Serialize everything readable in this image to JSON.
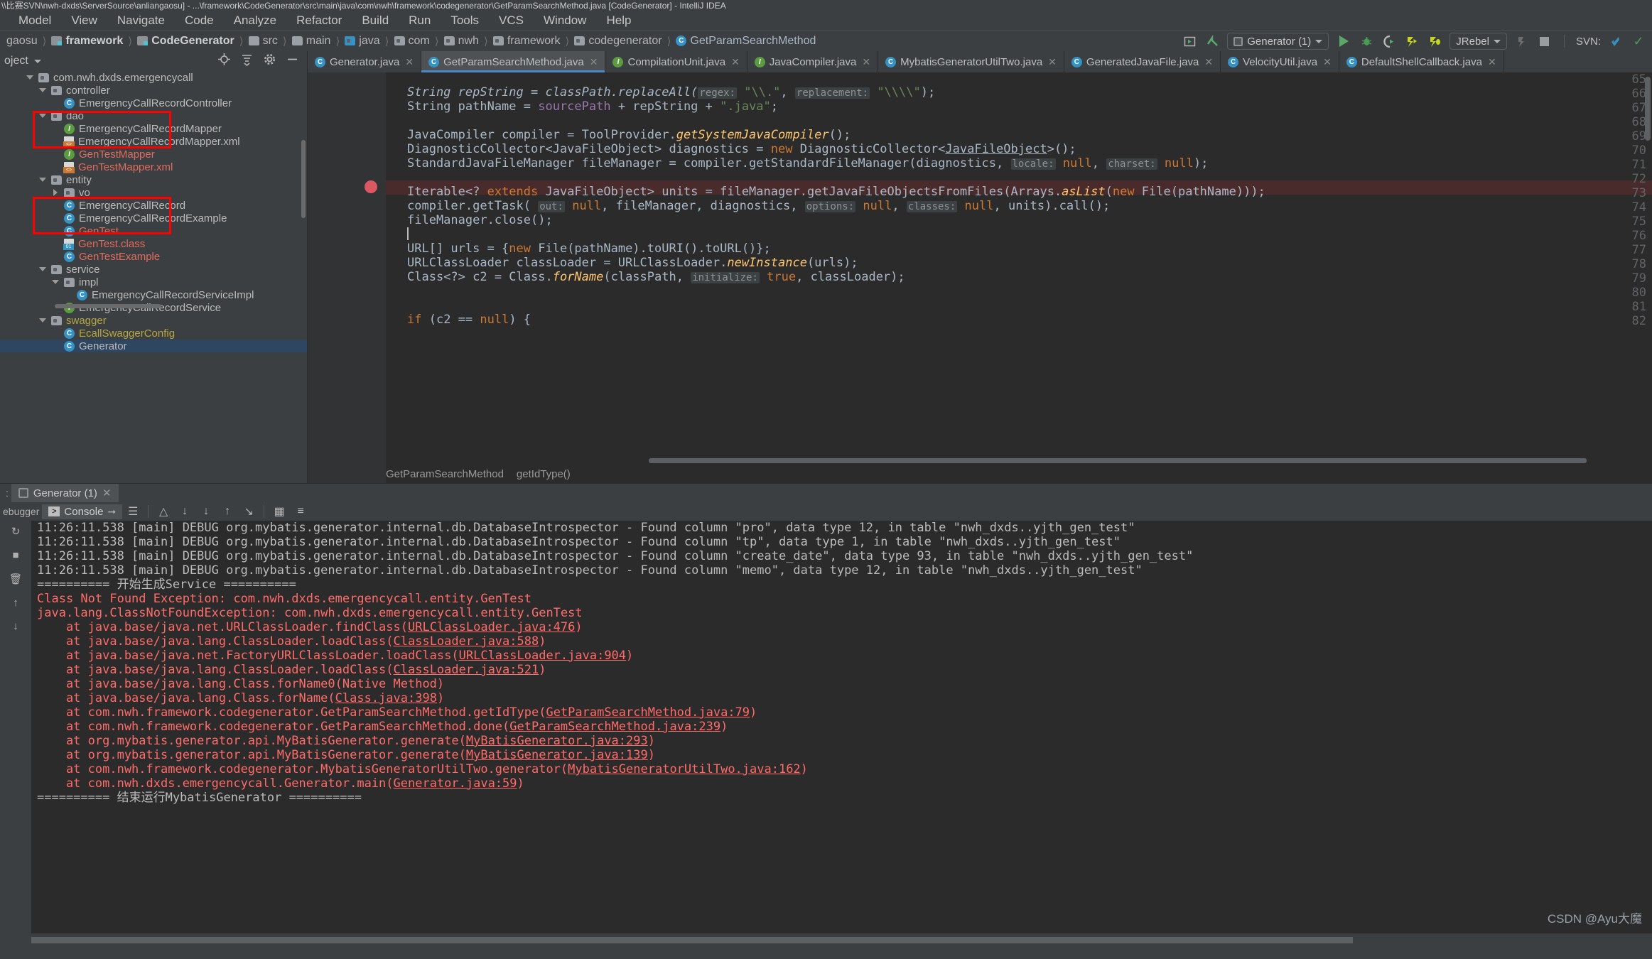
{
  "window": {
    "title": "\\\\比赛SVN\\nwh-dxds\\ServerSource\\anliangaosu] - ...\\framework\\CodeGenerator\\src\\main\\java\\com\\nwh\\framework\\codegenerator\\GetParamSearchMethod.java [CodeGenerator] - IntelliJ IDEA"
  },
  "menubar": {
    "items": [
      "Model",
      "View",
      "Navigate",
      "Code",
      "Analyze",
      "Refactor",
      "Build",
      "Run",
      "Tools",
      "VCS",
      "Window",
      "Help"
    ]
  },
  "navbar": {
    "crumbs": [
      {
        "label": "gaosu",
        "icon": "none",
        "style": "plain"
      },
      {
        "label": "framework",
        "icon": "module-icon",
        "style": "bold"
      },
      {
        "label": "CodeGenerator",
        "icon": "module-icon",
        "style": "bold"
      },
      {
        "label": "src",
        "icon": "folder-icon",
        "style": "plain"
      },
      {
        "label": "main",
        "icon": "folder-icon",
        "style": "plain"
      },
      {
        "label": "java",
        "icon": "folder-blue-icon",
        "style": "plain"
      },
      {
        "label": "com",
        "icon": "package-icon",
        "style": "plain"
      },
      {
        "label": "nwh",
        "icon": "package-icon",
        "style": "plain"
      },
      {
        "label": "framework",
        "icon": "package-icon",
        "style": "plain"
      },
      {
        "label": "codegenerator",
        "icon": "package-icon",
        "style": "plain"
      },
      {
        "label": "GetParamSearchMethod",
        "icon": "class-icon",
        "style": "class"
      }
    ],
    "run_config": "Generator (1)",
    "jrebel_label": "JRebel",
    "svn_label": "SVN:"
  },
  "project": {
    "title": "oject",
    "actions": [
      "locate-icon",
      "collapse-all-icon",
      "gear-icon",
      "hide-icon"
    ],
    "tree": [
      {
        "indent": 2,
        "arrow": "down",
        "icon": "package-icon",
        "label": "com.nwh.dxds.emergencycall",
        "color": "white"
      },
      {
        "indent": 3,
        "arrow": "down",
        "icon": "package-icon",
        "label": "controller",
        "color": "white"
      },
      {
        "indent": 4,
        "arrow": "none",
        "icon": "class-icon",
        "label": "EmergencyCallRecordController",
        "color": "white"
      },
      {
        "indent": 3,
        "arrow": "down",
        "icon": "package-icon",
        "label": "dao",
        "color": "white"
      },
      {
        "indent": 4,
        "arrow": "none",
        "icon": "interface-icon",
        "label": "EmergencyCallRecordMapper",
        "color": "white"
      },
      {
        "indent": 4,
        "arrow": "none",
        "icon": "xml-icon",
        "label": "EmergencyCallRecordMapper.xml",
        "color": "white"
      },
      {
        "indent": 4,
        "arrow": "none",
        "icon": "interface-icon",
        "label": "GenTestMapper",
        "color": "red"
      },
      {
        "indent": 4,
        "arrow": "none",
        "icon": "xml-icon",
        "label": "GenTestMapper.xml",
        "color": "red"
      },
      {
        "indent": 3,
        "arrow": "down",
        "icon": "package-icon",
        "label": "entity",
        "color": "white"
      },
      {
        "indent": 4,
        "arrow": "right",
        "icon": "package-icon",
        "label": "vo",
        "color": "white"
      },
      {
        "indent": 4,
        "arrow": "none",
        "icon": "class-icon",
        "label": "EmergencyCallRecord",
        "color": "white"
      },
      {
        "indent": 4,
        "arrow": "none",
        "icon": "class-icon",
        "label": "EmergencyCallRecordExample",
        "color": "white"
      },
      {
        "indent": 4,
        "arrow": "none",
        "icon": "class-icon",
        "label": "GenTest",
        "color": "red"
      },
      {
        "indent": 4,
        "arrow": "none",
        "icon": "classfile-icon",
        "label": "GenTest.class",
        "color": "red"
      },
      {
        "indent": 4,
        "arrow": "none",
        "icon": "class-icon",
        "label": "GenTestExample",
        "color": "red"
      },
      {
        "indent": 3,
        "arrow": "down",
        "icon": "package-icon",
        "label": "service",
        "color": "white"
      },
      {
        "indent": 4,
        "arrow": "down",
        "icon": "package-icon",
        "label": "impl",
        "color": "white"
      },
      {
        "indent": 5,
        "arrow": "none",
        "icon": "class-icon",
        "label": "EmergencyCallRecordServiceImpl",
        "color": "white"
      },
      {
        "indent": 4,
        "arrow": "none",
        "icon": "interface-icon",
        "label": "EmergencyCallRecordService",
        "color": "white"
      },
      {
        "indent": 3,
        "arrow": "down",
        "icon": "package-icon",
        "label": "swagger",
        "color": "yellow"
      },
      {
        "indent": 4,
        "arrow": "none",
        "icon": "class-icon",
        "label": "EcallSwaggerConfig",
        "color": "yellow"
      },
      {
        "indent": 4,
        "arrow": "none",
        "icon": "class-icon",
        "label": "Generator",
        "color": "selected"
      }
    ]
  },
  "editor": {
    "tabs": [
      {
        "label": "Generator.java",
        "icon": "class-icon",
        "active": false
      },
      {
        "label": "GetParamSearchMethod.java",
        "icon": "class-icon",
        "active": true
      },
      {
        "label": "CompilationUnit.java",
        "icon": "interface-icon",
        "active": false
      },
      {
        "label": "JavaCompiler.java",
        "icon": "interface-icon",
        "active": false
      },
      {
        "label": "MybatisGeneratorUtilTwo.java",
        "icon": "class-icon",
        "active": false
      },
      {
        "label": "GeneratedJavaFile.java",
        "icon": "class-icon",
        "active": false
      },
      {
        "label": "VelocityUtil.java",
        "icon": "class-icon",
        "active": false
      },
      {
        "label": "DefaultShellCallback.java",
        "icon": "class-icon",
        "active": false
      }
    ],
    "line_numbers": [
      "65",
      "66",
      "67",
      "68",
      "69",
      "70",
      "71",
      "72",
      "73",
      "74",
      "75",
      "76",
      "77",
      "78",
      "79",
      "80",
      "81",
      "82"
    ],
    "breadcrumb": [
      "GetParamSearchMethod",
      "getIdType()"
    ]
  },
  "run_window": {
    "left_label": ":",
    "tab_label": "Generator (1)",
    "debugger_label": "ebugger",
    "console_label": "Console",
    "console_lines": [
      {
        "text": "11:26:11.538 [main] DEBUG org.mybatis.generator.internal.db.DatabaseIntrospector - Found column \"pro\", data type 12, in table \"nwh_dxds..yjth_gen_test\"",
        "type": "info"
      },
      {
        "text": "11:26:11.538 [main] DEBUG org.mybatis.generator.internal.db.DatabaseIntrospector - Found column \"tp\", data type 1, in table \"nwh_dxds..yjth_gen_test\"",
        "type": "info"
      },
      {
        "text": "11:26:11.538 [main] DEBUG org.mybatis.generator.internal.db.DatabaseIntrospector - Found column \"create_date\", data type 93, in table \"nwh_dxds..yjth_gen_test\"",
        "type": "info"
      },
      {
        "text": "11:26:11.538 [main] DEBUG org.mybatis.generator.internal.db.DatabaseIntrospector - Found column \"memo\", data type 12, in table \"nwh_dxds..yjth_gen_test\"",
        "type": "info"
      },
      {
        "text": "========== 开始生成Service ==========",
        "type": "info"
      },
      {
        "text": "Class Not Found Exception: com.nwh.dxds.emergencycall.entity.GenTest",
        "type": "error"
      },
      {
        "text": "java.lang.ClassNotFoundException: com.nwh.dxds.emergencycall.entity.GenTest",
        "type": "error"
      },
      {
        "text": "    at java.base/java.net.URLClassLoader.findClass(URLClassLoader.java:476)",
        "type": "error"
      },
      {
        "text": "    at java.base/java.lang.ClassLoader.loadClass(ClassLoader.java:588)",
        "type": "error"
      },
      {
        "text": "    at java.base/java.net.FactoryURLClassLoader.loadClass(URLClassLoader.java:904)",
        "type": "error"
      },
      {
        "text": "    at java.base/java.lang.ClassLoader.loadClass(ClassLoader.java:521)",
        "type": "error"
      },
      {
        "text": "    at java.base/java.lang.Class.forName0(Native Method)",
        "type": "error"
      },
      {
        "text": "    at java.base/java.lang.Class.forName(Class.java:398)",
        "type": "error"
      },
      {
        "text": "    at com.nwh.framework.codegenerator.GetParamSearchMethod.getIdType(GetParamSearchMethod.java:79)",
        "type": "error"
      },
      {
        "text": "    at com.nwh.framework.codegenerator.GetParamSearchMethod.done(GetParamSearchMethod.java:239)",
        "type": "error"
      },
      {
        "text": "    at org.mybatis.generator.api.MyBatisGenerator.generate(MyBatisGenerator.java:293)",
        "type": "error"
      },
      {
        "text": "    at org.mybatis.generator.api.MyBatisGenerator.generate(MyBatisGenerator.java:139)",
        "type": "error"
      },
      {
        "text": "    at com.nwh.framework.codegenerator.MybatisGeneratorUtilTwo.generator(MybatisGeneratorUtilTwo.java:162)",
        "type": "error"
      },
      {
        "text": "    at com.nwh.dxds.emergencycall.Generator.main(Generator.java:59)",
        "type": "error"
      },
      {
        "text": "========== 结束运行MybatisGenerator ==========",
        "type": "info"
      }
    ]
  },
  "watermark": "CSDN @Ayu大魔",
  "colors": {
    "accent": "#3592c4",
    "error": "#ff6b68",
    "highlight_box": "#ff0000",
    "editor_bg": "#2b2b2b",
    "panel_bg": "#3c3f41"
  }
}
